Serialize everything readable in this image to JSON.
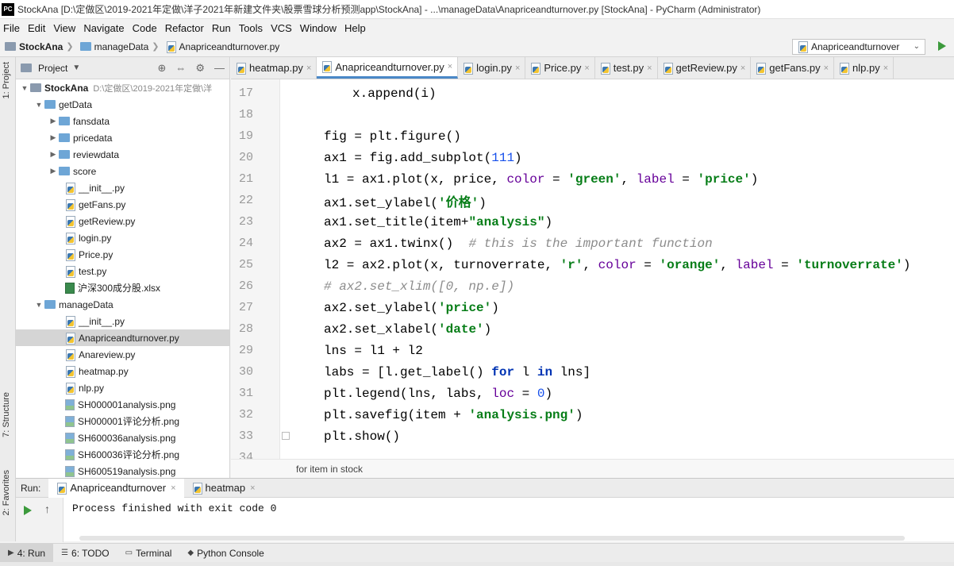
{
  "window": {
    "logo": "PC",
    "title": "StockAna [D:\\定做区\\2019-2021年定做\\洋子2021年新建文件夹\\股票雪球分析预测app\\StockAna] - ...\\manageData\\Anapriceandturnover.py [StockAna] - PyCharm (Administrator)"
  },
  "menu": [
    "File",
    "Edit",
    "View",
    "Navigate",
    "Code",
    "Refactor",
    "Run",
    "Tools",
    "VCS",
    "Window",
    "Help"
  ],
  "nav": {
    "project": "StockAna",
    "folder": "manageData",
    "file": "Anapriceandturnover.py",
    "run_config": "Anapriceandturnover"
  },
  "left_strip": {
    "project_tab": "1: Project",
    "structure_tab": "7: Structure",
    "favorites_tab": "2: Favorites"
  },
  "project_panel": {
    "header": "Project",
    "root": {
      "name": "StockAna",
      "path": "D:\\定做区\\2019-2021年定做\\洋"
    },
    "items": [
      {
        "label": "getData"
      },
      {
        "label": "fansdata"
      },
      {
        "label": "pricedata"
      },
      {
        "label": "reviewdata"
      },
      {
        "label": "score"
      },
      {
        "label": "__init__.py"
      },
      {
        "label": "getFans.py"
      },
      {
        "label": "getReview.py"
      },
      {
        "label": "login.py"
      },
      {
        "label": "Price.py"
      },
      {
        "label": "test.py"
      },
      {
        "label": "沪深300成分股.xlsx"
      },
      {
        "label": "manageData"
      },
      {
        "label": "__init__.py"
      },
      {
        "label": "Anapriceandturnover.py"
      },
      {
        "label": "Anareview.py"
      },
      {
        "label": "heatmap.py"
      },
      {
        "label": "nlp.py"
      },
      {
        "label": "SH000001analysis.png"
      },
      {
        "label": "SH000001评论分析.png"
      },
      {
        "label": "SH600036analysis.png"
      },
      {
        "label": "SH600036评论分析.png"
      },
      {
        "label": "SH600519analysis.png"
      }
    ]
  },
  "editor_tabs": [
    "heatmap.py",
    "Anapriceandturnover.py",
    "login.py",
    "Price.py",
    "test.py",
    "getReview.py",
    "getFans.py",
    "nlp.py"
  ],
  "editor": {
    "line_numbers": [
      "17",
      "18",
      "19",
      "20",
      "21",
      "22",
      "23",
      "24",
      "25",
      "26",
      "27",
      "28",
      "29",
      "30",
      "31",
      "32",
      "33",
      "34"
    ],
    "breadcrumb": "for item in stock"
  },
  "run_panel": {
    "label": "Run:",
    "tabs": [
      "Anapriceandturnover",
      "heatmap"
    ],
    "output": "Process finished with exit code 0"
  },
  "bottom_tools": [
    "4: Run",
    "6: TODO",
    "Terminal",
    "Python Console"
  ]
}
